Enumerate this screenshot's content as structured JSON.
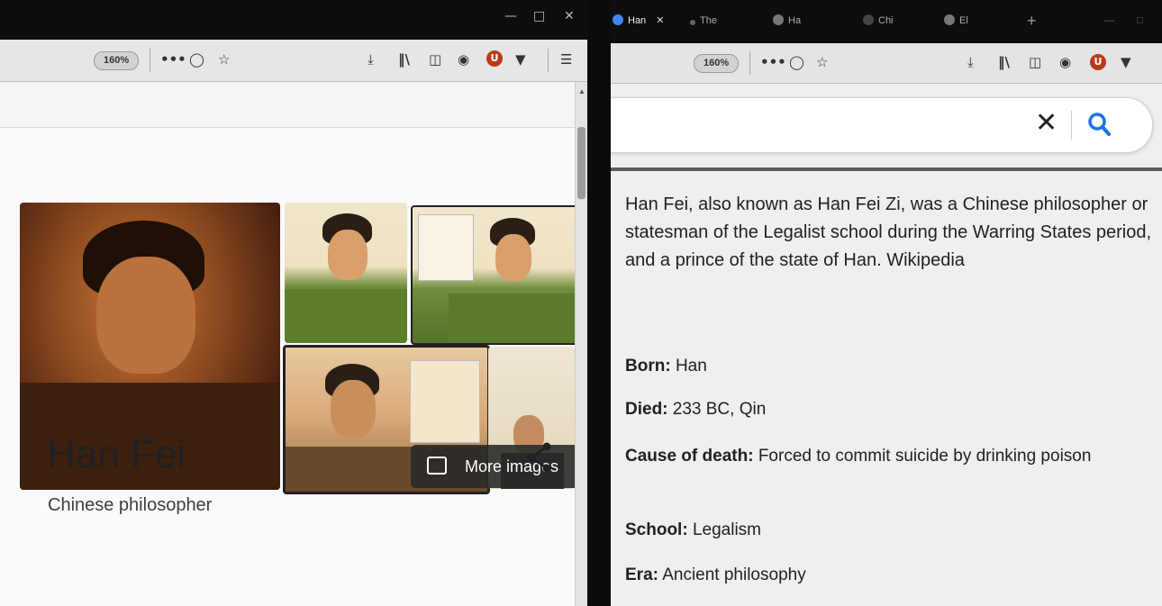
{
  "left_window": {
    "toolbar": {
      "zoom": "160%",
      "menu": "•••"
    },
    "more_images_label": "More images",
    "knowledge_panel": {
      "title": "Han Fei",
      "subtitle": "Chinese philosopher"
    }
  },
  "right_window": {
    "tabs": [
      {
        "label": "Han",
        "active": true
      },
      {
        "label": "The",
        "active": false
      },
      {
        "label": "Ha",
        "active": false
      },
      {
        "label": "Chi",
        "active": false
      },
      {
        "label": "El",
        "active": false
      }
    ],
    "toolbar": {
      "zoom": "160%",
      "menu": "•••"
    },
    "description": "Han Fei, also known as Han Fei Zi, was a Chinese philosopher or statesman of the Legalist school during the Warring States period, and a prince of the state of Han.",
    "source_link": "Wikipedia",
    "facts": [
      {
        "label": "Born:",
        "value": "Han"
      },
      {
        "label": "Died:",
        "value": "233 BC, Qin"
      },
      {
        "label": "Cause of death:",
        "value": "Forced to commit suicide by drinking poison"
      },
      {
        "label": "School:",
        "value": "Legalism"
      },
      {
        "label": "Era:",
        "value": "Ancient philosophy"
      }
    ]
  },
  "icons": {
    "download": "download-icon",
    "library": "library-icon",
    "reader": "reader-view-icon",
    "pocket": "pocket-icon",
    "bookmark": "bookmark-star-icon",
    "share": "share-icon",
    "search": "search-icon",
    "clear": "clear-icon",
    "images": "image-icon"
  },
  "colors": {
    "title_text": "#202124",
    "more_images_bg": "#282828",
    "ublock_red": "#b83b19"
  }
}
